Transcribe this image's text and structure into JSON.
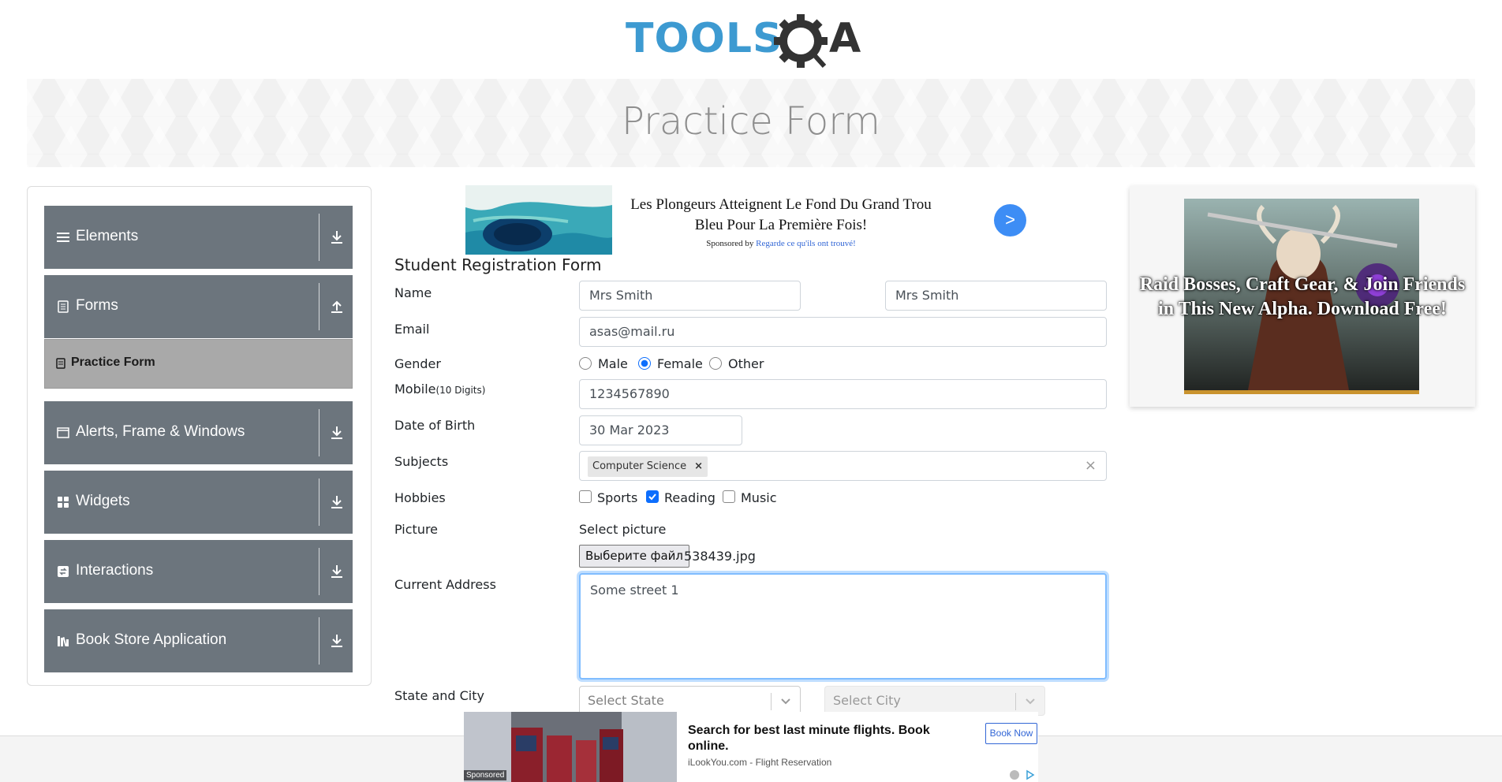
{
  "header": {
    "logo_text": "TOOLSQA"
  },
  "banner": {
    "title": "Practice Form"
  },
  "sidebar": {
    "groups": [
      {
        "label": "Elements",
        "icon": "hamburger-icon",
        "arrow": "download-arrow-icon"
      },
      {
        "label": "Forms",
        "icon": "document-icon",
        "arrow": "upload-arrow-icon"
      },
      {
        "label": "Alerts, Frame & Windows",
        "icon": "window-icon",
        "arrow": "download-arrow-icon"
      },
      {
        "label": "Widgets",
        "icon": "grid-icon",
        "arrow": "download-arrow-icon"
      },
      {
        "label": "Interactions",
        "icon": "interaction-icon",
        "arrow": "download-arrow-icon"
      },
      {
        "label": "Book Store Application",
        "icon": "books-icon",
        "arrow": "download-arrow-icon"
      }
    ],
    "active_item": "Practice Form"
  },
  "top_ad": {
    "title": "Les Plongeurs Atteignent Le Fond Du Grand Trou Bleu Pour La Première Fois!",
    "sponsored_prefix": "Sponsored by",
    "sponsor": "Regarde ce qu'ils ont trouvé!",
    "button": ">"
  },
  "form": {
    "title": "Student Registration Form",
    "name_label": "Name",
    "first_name": "Mrs Smith",
    "last_name": "Mrs Smith",
    "email_label": "Email",
    "email": "asas@mail.ru",
    "gender_label": "Gender",
    "gender_options": [
      "Male",
      "Female",
      "Other"
    ],
    "gender_selected": "Female",
    "mobile_label": "Mobile",
    "mobile_hint": "(10 Digits)",
    "mobile": "1234567890",
    "dob_label": "Date of Birth",
    "dob": "30 Mar 2023",
    "subjects_label": "Subjects",
    "subject_chip": "Computer Science",
    "subject_remove": "×",
    "subjects_clear": "×",
    "hobbies_label": "Hobbies",
    "hobbies": [
      {
        "label": "Sports",
        "checked": false
      },
      {
        "label": "Reading",
        "checked": true
      },
      {
        "label": "Music",
        "checked": false
      }
    ],
    "picture_label": "Picture",
    "select_picture": "Select picture",
    "file_button": "Выберите файл",
    "file_name": "538439.jpg",
    "address_label": "Current Address",
    "address": "Some street 1",
    "state_city_label": "State and City",
    "state_placeholder": "Select State",
    "city_placeholder": "Select City"
  },
  "right_ad": {
    "text": "Raid Bosses, Craft Gear, & Join Friends in This New Alpha. Download Free!"
  },
  "bottom_ad": {
    "title": "Search for best last minute flights. Book online.",
    "source": "iLookYou.com - Flight Reservation",
    "button": "Book Now",
    "sponsored": "Sponsored"
  },
  "colors": {
    "accent": "#0d6efd",
    "menu_bg": "#6c757d",
    "active_bg": "#a9a9a9",
    "logo_blue": "#3d9ad1",
    "logo_dark": "#222222"
  }
}
